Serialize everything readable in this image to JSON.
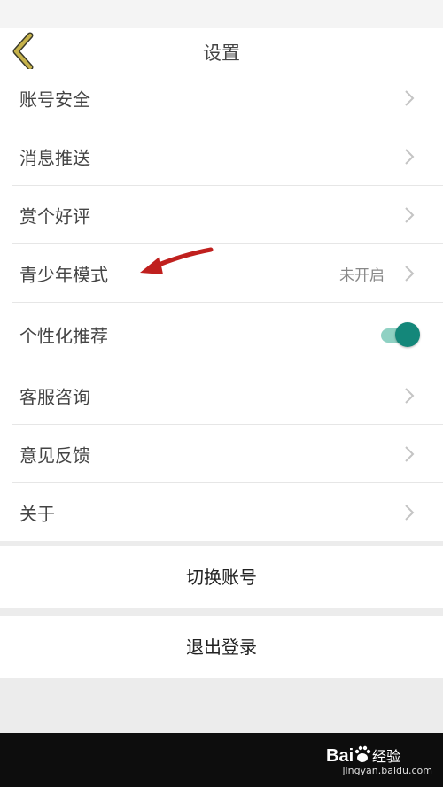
{
  "header": {
    "title": "设置"
  },
  "settings": {
    "items": [
      {
        "label": "账号安全"
      },
      {
        "label": "消息推送"
      },
      {
        "label": "赏个好评"
      },
      {
        "label": "青少年模式",
        "value": "未开启"
      },
      {
        "label": "个性化推荐",
        "toggle_on": true
      },
      {
        "label": "客服咨询"
      },
      {
        "label": "意见反馈"
      },
      {
        "label": "关于"
      }
    ]
  },
  "actions": {
    "switch_account": "切换账号",
    "logout": "退出登录"
  },
  "watermark": {
    "logo_text": "Bai 经验",
    "site": "jingyan.baidu.com"
  },
  "colors": {
    "accent": "#14877a",
    "toggle_track": "#8fd1c3",
    "back_arrow": "#c6b24a",
    "annotation_arrow": "#c0201e"
  }
}
